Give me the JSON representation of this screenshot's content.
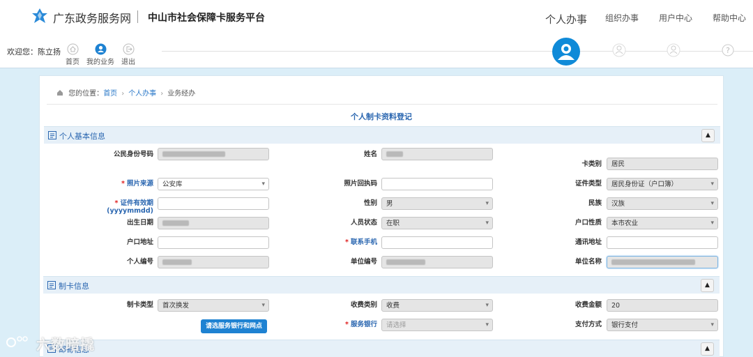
{
  "header": {
    "site_name": "广东政务服务网",
    "platform_name": "中山市社会保障卡服务平台",
    "nav": [
      "个人办事",
      "组织办事",
      "用户中心",
      "帮助中心"
    ],
    "welcome": "欢迎您：陈立扬",
    "subnav": [
      "首页",
      "我的业务",
      "退出"
    ]
  },
  "breadcrumb": {
    "prefix": "您的位置：",
    "items": [
      "首页",
      "个人办事",
      "业务经办"
    ]
  },
  "form_title": "个人制卡资料登记",
  "sections": {
    "basic": "个人基本信息",
    "card": "制卡信息",
    "third": "邮寄信息"
  },
  "basic": {
    "id_label": "公民身份号码",
    "name_label": "姓名",
    "card_type_label": "卡类别",
    "card_type_value": "居民",
    "photo_src_label": "照片来源",
    "photo_src_value": "公安库",
    "photo_receipt_label": "照片回执码",
    "doc_type_label": "证件类型",
    "doc_type_value": "居民身份证（户口簿）",
    "validity_label": "证件有效期(yyyymmdd)",
    "gender_label": "性别",
    "gender_value": "男",
    "ethnicity_label": "民族",
    "ethnicity_value": "汉族",
    "birth_label": "出生日期",
    "status_label": "人员状态",
    "status_value": "在职",
    "hukou_type_label": "户口性质",
    "hukou_type_value": "本市农业",
    "hukou_addr_label": "户口地址",
    "phone_label": "联系手机",
    "mail_addr_label": "通讯地址",
    "person_no_label": "个人编号",
    "unit_no_label": "单位编号",
    "unit_name_label": "单位名称"
  },
  "card": {
    "make_type_label": "制卡类型",
    "make_type_value": "首次换发",
    "fee_type_label": "收费类别",
    "fee_type_value": "收费",
    "fee_amount_label": "收费金额",
    "fee_amount_value": "20",
    "bank_button": "请选服务银行和网点",
    "bank_label": "服务银行",
    "bank_placeholder": "请选择",
    "pay_label": "支付方式",
    "pay_value": "银行支付"
  },
  "watermark": "六数暗撬",
  "colors": {
    "accent": "#0f8ad8",
    "link": "#2a78c8",
    "section_bg": "#e6f0f8",
    "required": "#e02020"
  }
}
